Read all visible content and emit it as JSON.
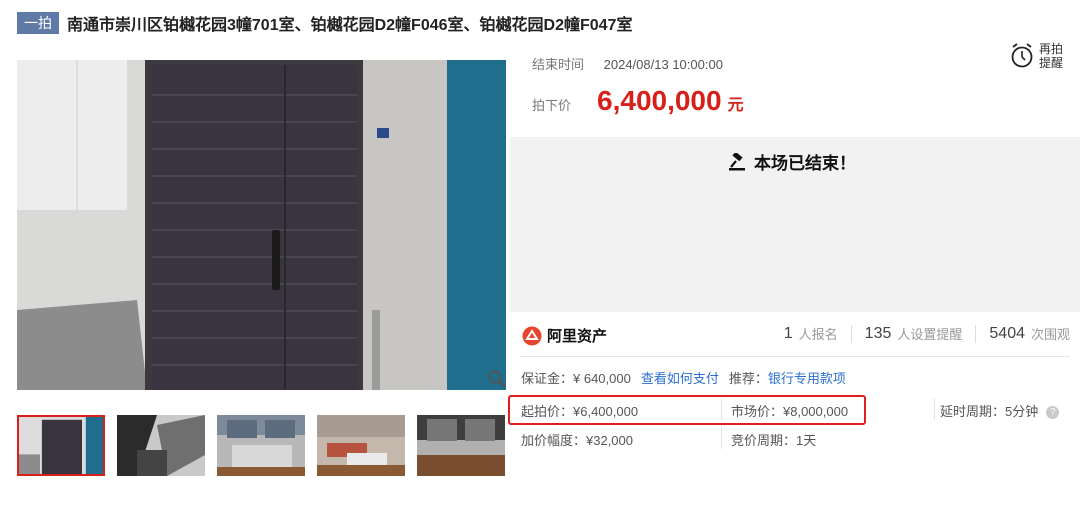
{
  "title": {
    "tag": "一拍",
    "text": "南通市崇川区铂樾花园3幢701室、铂樾花园D2幢F046室、铂樾花园D2幢F047室"
  },
  "auction": {
    "end_label": "结束时间",
    "end_time": "2024/08/13 10:00:00",
    "price_label": "拍下价",
    "price": "6,400,000",
    "price_unit": "元",
    "remind_label": "再拍提醒",
    "status": "本场已结束！"
  },
  "stats": {
    "brand": "阿里资产",
    "signup_count": "1",
    "signup_label": "人报名",
    "remind_count": "135",
    "remind_label": "人设置提醒",
    "view_count": "5404",
    "view_label": "次围观"
  },
  "details": {
    "deposit": "保证金：¥ 640,000",
    "pay_link": "查看如何支付",
    "recommend_label": "推荐：",
    "recommend_link": "银行专用款项",
    "start_price": "起拍价：¥6,400,000",
    "market_price": "市场价：¥8,000,000",
    "delay_period": "延时周期：5分钟",
    "increment": "加价幅度：¥32,000",
    "bid_period": "竞价周期：1天"
  },
  "icons": {
    "zoom": "search-icon",
    "alarm": "alarm-clock-icon",
    "gavel": "gavel-icon",
    "help": "help-icon",
    "brand": "ali-logo-icon"
  },
  "colors": {
    "accent_red": "#d8201b",
    "link_blue": "#2a6fd1",
    "tag_blue": "#5f7aa6"
  }
}
